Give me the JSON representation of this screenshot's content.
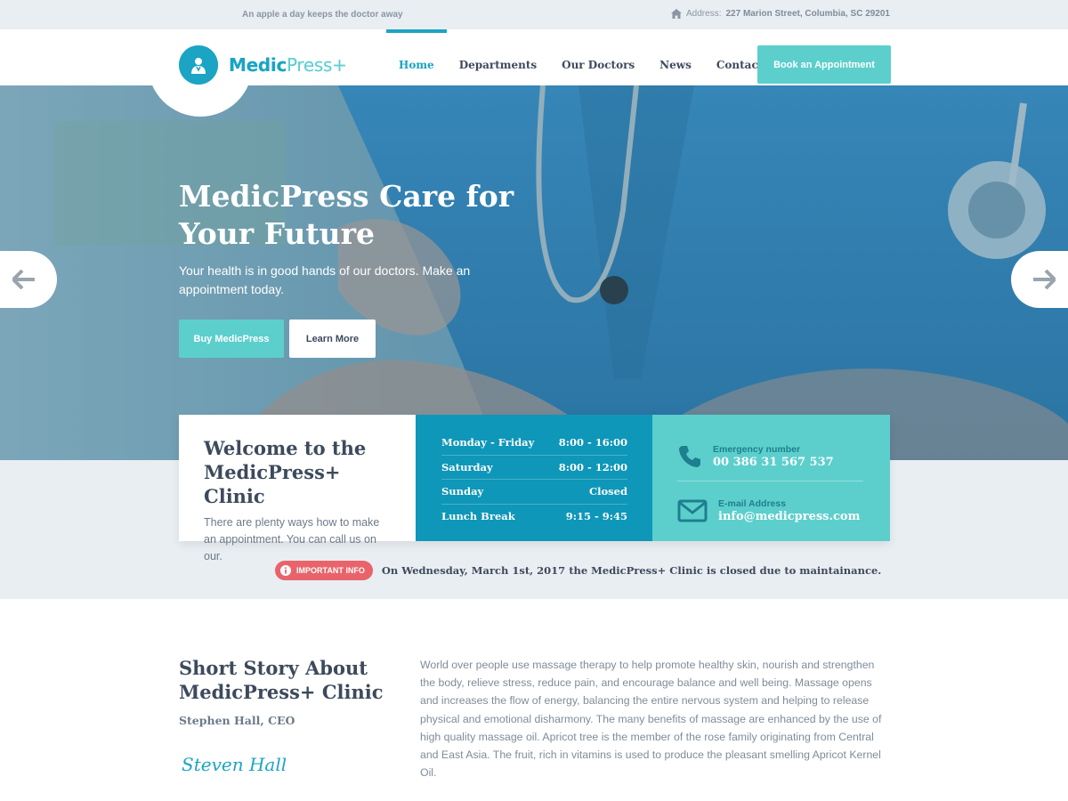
{
  "topbar": {
    "tagline": "An apple a day keeps the doctor away",
    "address_label": "Address:",
    "address_value": "227 Marion Street, Columbia, SC 29201"
  },
  "brand": {
    "name_primary": "Medic",
    "name_secondary": "Press+",
    "logo_icon": "doctor-icon"
  },
  "nav": {
    "items": [
      {
        "label": "Home",
        "active": true
      },
      {
        "label": "Departments",
        "active": false
      },
      {
        "label": "Our Doctors",
        "active": false
      },
      {
        "label": "News",
        "active": false
      },
      {
        "label": "Contact Us",
        "active": false
      }
    ],
    "cta": "Book an Appointment"
  },
  "hero": {
    "title": "MedicPress Care for Your Future",
    "subtitle": "Your health is in good hands of our doctors. Make an appointment today.",
    "primary_button": "Buy MedicPress",
    "secondary_button": "Learn More",
    "prev_icon": "arrow-left-icon",
    "next_icon": "arrow-right-icon"
  },
  "welcome": {
    "title": "Welcome to the MedicPress+ Clinic",
    "text": "There are plenty ways how to make an appointment. You can call us on our."
  },
  "hours": [
    {
      "day": "Monday - Friday",
      "time": "8:00 - 16:00"
    },
    {
      "day": "Saturday",
      "time": "8:00 - 12:00"
    },
    {
      "day": "Sunday",
      "time": "Closed"
    },
    {
      "day": "Lunch Break",
      "time": "9:15 - 9:45"
    }
  ],
  "contact": {
    "phone_label": "Emergency number",
    "phone_value": "00 386 31 567 537",
    "email_label": "E-mail Address",
    "email_value": "info@medicpress.com"
  },
  "notice": {
    "badge": "IMPORTANT INFO",
    "text": "On Wednesday, March 1st, 2017 the MedicPress+ Clinic is closed due to maintainance."
  },
  "story": {
    "title": "Short Story About MedicPress+ Clinic",
    "author": "Stephen Hall, CEO",
    "signature": "Steven Hall",
    "body": "World over people use massage therapy to help promote healthy skin, nourish and strengthen the body, relieve stress, reduce pain, and encourage balance and well being. Massage opens and increases the flow of energy, balancing the entire nervous system and helping to release physical and emotional disharmony. The many benefits of massage are enhanced by the use of high quality massage oil. Apricot tree is the member of the rose family originating from Central and East Asia. The fruit, rich in vitamins is used to produce the pleasant smelling Apricot Kernel Oil."
  },
  "colors": {
    "primary": "#1ba4c4",
    "accent": "#5ccfcc",
    "hours_bg": "#0e97b9",
    "alert": "#e8646a",
    "text_dark": "#3d4a5c"
  }
}
